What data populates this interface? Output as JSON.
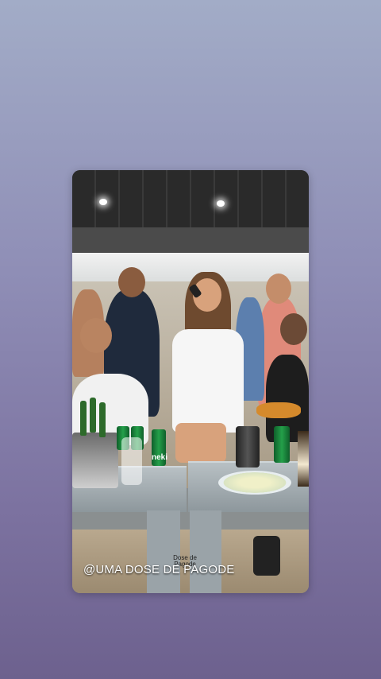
{
  "story": {
    "caption": "@UMA DOSE DE PAGODE",
    "watermark_line1": "Dose de",
    "watermark_line2": "Pagode",
    "can_label": "neki"
  },
  "colors": {
    "background_top": "#a2acc7",
    "background_bottom": "#6d618e",
    "caption_text": "#ffffff"
  }
}
